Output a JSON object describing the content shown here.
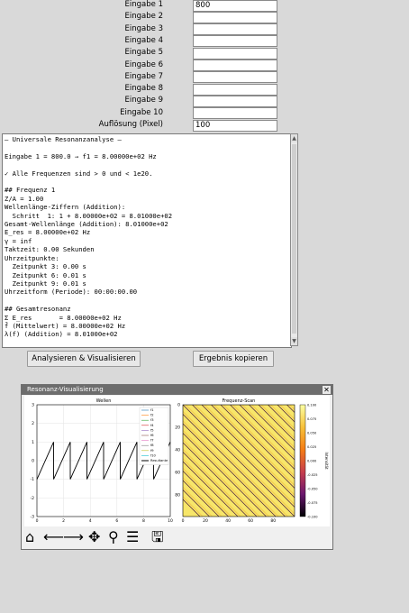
{
  "inputs": [
    {
      "label": "Eingabe 1",
      "value": "800"
    },
    {
      "label": "Eingabe 2",
      "value": ""
    },
    {
      "label": "Eingabe 3",
      "value": ""
    },
    {
      "label": "Eingabe 4",
      "value": ""
    },
    {
      "label": "Eingabe 5",
      "value": ""
    },
    {
      "label": "Eingabe 6",
      "value": ""
    },
    {
      "label": "Eingabe 7",
      "value": ""
    },
    {
      "label": "Eingabe 8",
      "value": ""
    },
    {
      "label": "Eingabe 9",
      "value": ""
    },
    {
      "label": "Eingabe 10",
      "value": ""
    },
    {
      "label": "Auflösung (Pixel)",
      "value": "100"
    }
  ],
  "output_text": "— Universale Resonanzanalyse —\n\nEingabe 1 = 800.0 → f1 = 8.00000e+02 Hz\n\n✓ Alle Frequenzen sind > 0 und < 1e20.\n\n## Frequenz 1\nZ/A = 1.00\nWellenlänge-Ziffern (Addition):\n  Schritt  1: 1 + 8.00000e+02 = 8.01000e+02\nGesamt-Wellenlänge (Addition): 8.01000e+02\nE_res = 8.00000e+02 Hz\nγ = inf\nTaktzeit: 0.00 Sekunden\nUhrzeitpunkte:\n  Zeitpunkt 3: 0.00 s\n  Zeitpunkt 6: 0.01 s\n  Zeitpunkt 9: 0.01 s\nUhrzeitform (Periode): 00:00:00.00\n\n## Gesamtresonanz\nΣ E_res       = 8.00000e+02 Hz\nf̄ (Mittelwert) = 8.00000e+02 Hz\nλ(f) (Addition) = 8.01000e+02",
  "buttons": {
    "analyze": "Analysieren & Visualisieren",
    "copy": "Ergebnis kopieren"
  },
  "window": {
    "title": "Resonanz-Visualisierung",
    "close": "✕"
  },
  "toolbar_icons": [
    "home-icon",
    "back-icon",
    "forward-icon",
    "pan-icon",
    "zoom-icon",
    "configure-icon",
    "save-icon"
  ],
  "chart_data": [
    {
      "type": "line",
      "title": "Wellen",
      "xlim": [
        0,
        10
      ],
      "ylim": [
        -3,
        3
      ],
      "xticks": [
        0,
        2,
        4,
        6,
        8,
        10
      ],
      "yticks": [
        -3,
        -2,
        -1,
        0,
        1,
        2,
        3
      ],
      "grid": true,
      "legend_position": "top-right",
      "legend": [
        "f1",
        "f2",
        "f3",
        "f4",
        "f5",
        "f6",
        "f7",
        "f8",
        "f9",
        "f10",
        "Resultante"
      ],
      "series": [
        {
          "name": "Resultante",
          "color": "#000000",
          "shape": "sawtooth",
          "min": -1,
          "max": 1,
          "period": 1.25
        }
      ]
    },
    {
      "type": "heatmap",
      "title": "Frequenz-Scan",
      "xlim": [
        0,
        99
      ],
      "ylim": [
        0,
        99
      ],
      "xticks": [
        0,
        20,
        40,
        60,
        80
      ],
      "yticks": [
        0,
        20,
        40,
        60,
        80
      ],
      "colorbar_label": "Intensität",
      "colorbar_range": [
        -0.1,
        0.1
      ],
      "colorbar_ticks": [
        "0.100",
        "0.075",
        "0.050",
        "0.025",
        "0.000",
        "-0.025",
        "-0.050",
        "-0.075",
        "-0.100"
      ],
      "pattern": "diagonal stripes, mostly yellow (~0.09) with thin dark lines"
    }
  ]
}
